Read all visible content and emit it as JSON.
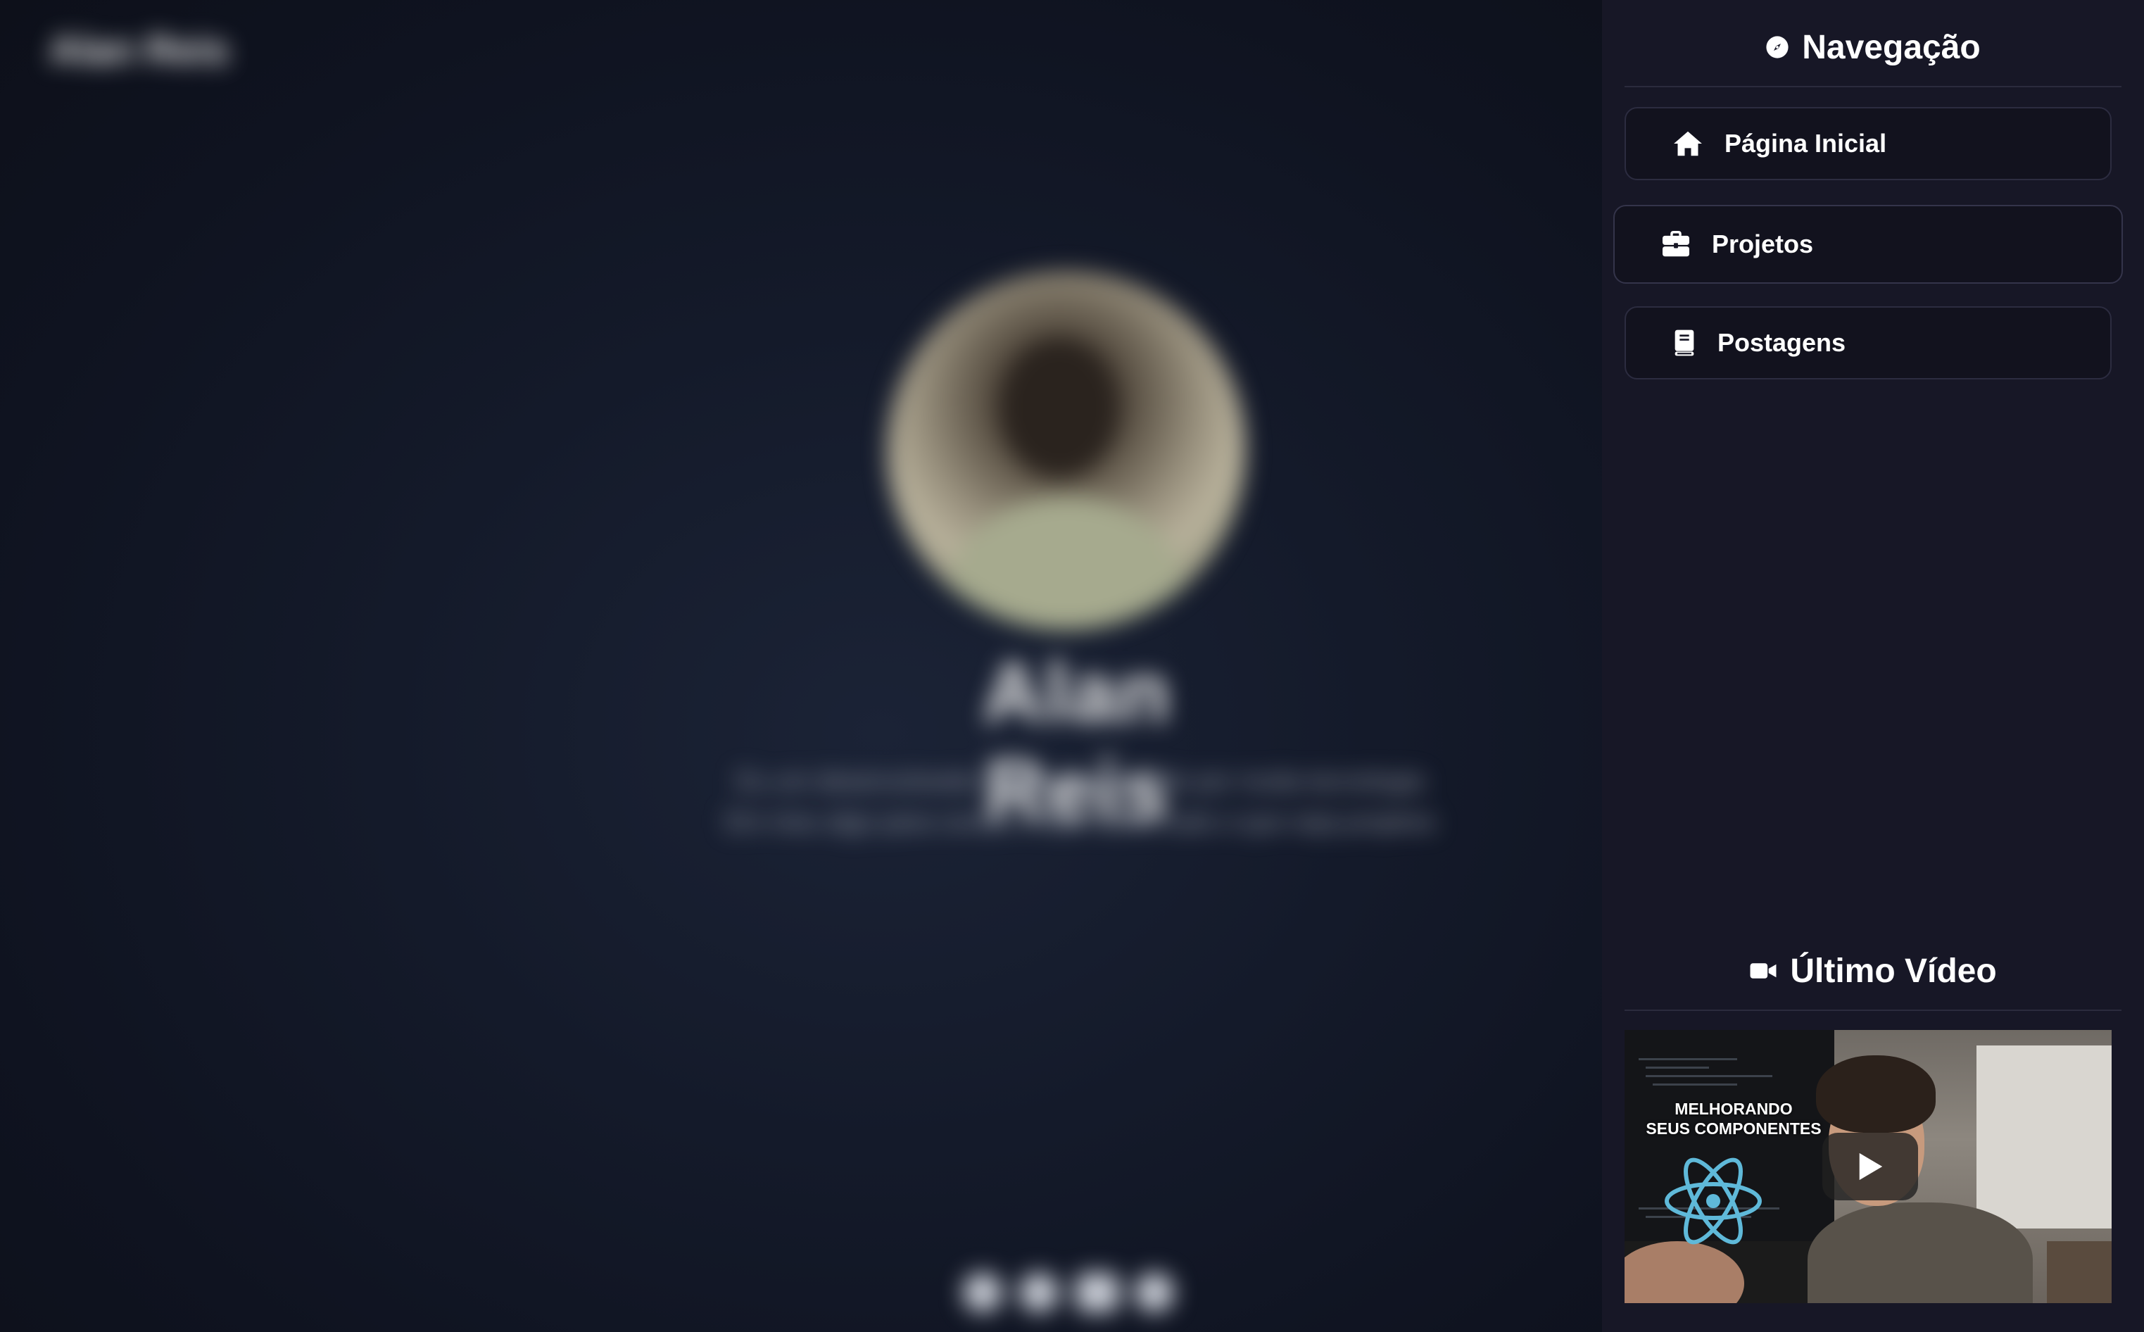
{
  "main": {
    "brand": "Alan Reis",
    "profile": {
      "name": "Alan Reis",
      "bio_line_1": "Eu um desenvolvedor muito apaixonado por muita tecnologia",
      "bio_line_2": "Em meu algo para contar e falar sobre tudo o que seja projetos"
    },
    "social_icons": [
      "github-icon",
      "linkedin-icon",
      "youtube-icon",
      "instagram-icon"
    ]
  },
  "sidebar": {
    "navigation": {
      "title": "Navegação",
      "icon": "compass-icon",
      "items": [
        {
          "label": "Página Inicial",
          "icon": "home-icon"
        },
        {
          "label": "Projetos",
          "icon": "briefcase-icon",
          "active": true
        },
        {
          "label": "Postagens",
          "icon": "book-icon"
        }
      ]
    },
    "latest_video": {
      "title": "Último Vídeo",
      "icon": "video-camera-icon",
      "thumbnail_text_line_1": "MELHORANDO",
      "thumbnail_text_line_2": "SEUS COMPONENTES"
    }
  },
  "colors": {
    "sidebar_bg": "#171726",
    "nav_item_bg": "#12121e",
    "nav_item_border": "#2c2c40",
    "text": "#ffffff",
    "react_blue": "#5fb9d9"
  }
}
